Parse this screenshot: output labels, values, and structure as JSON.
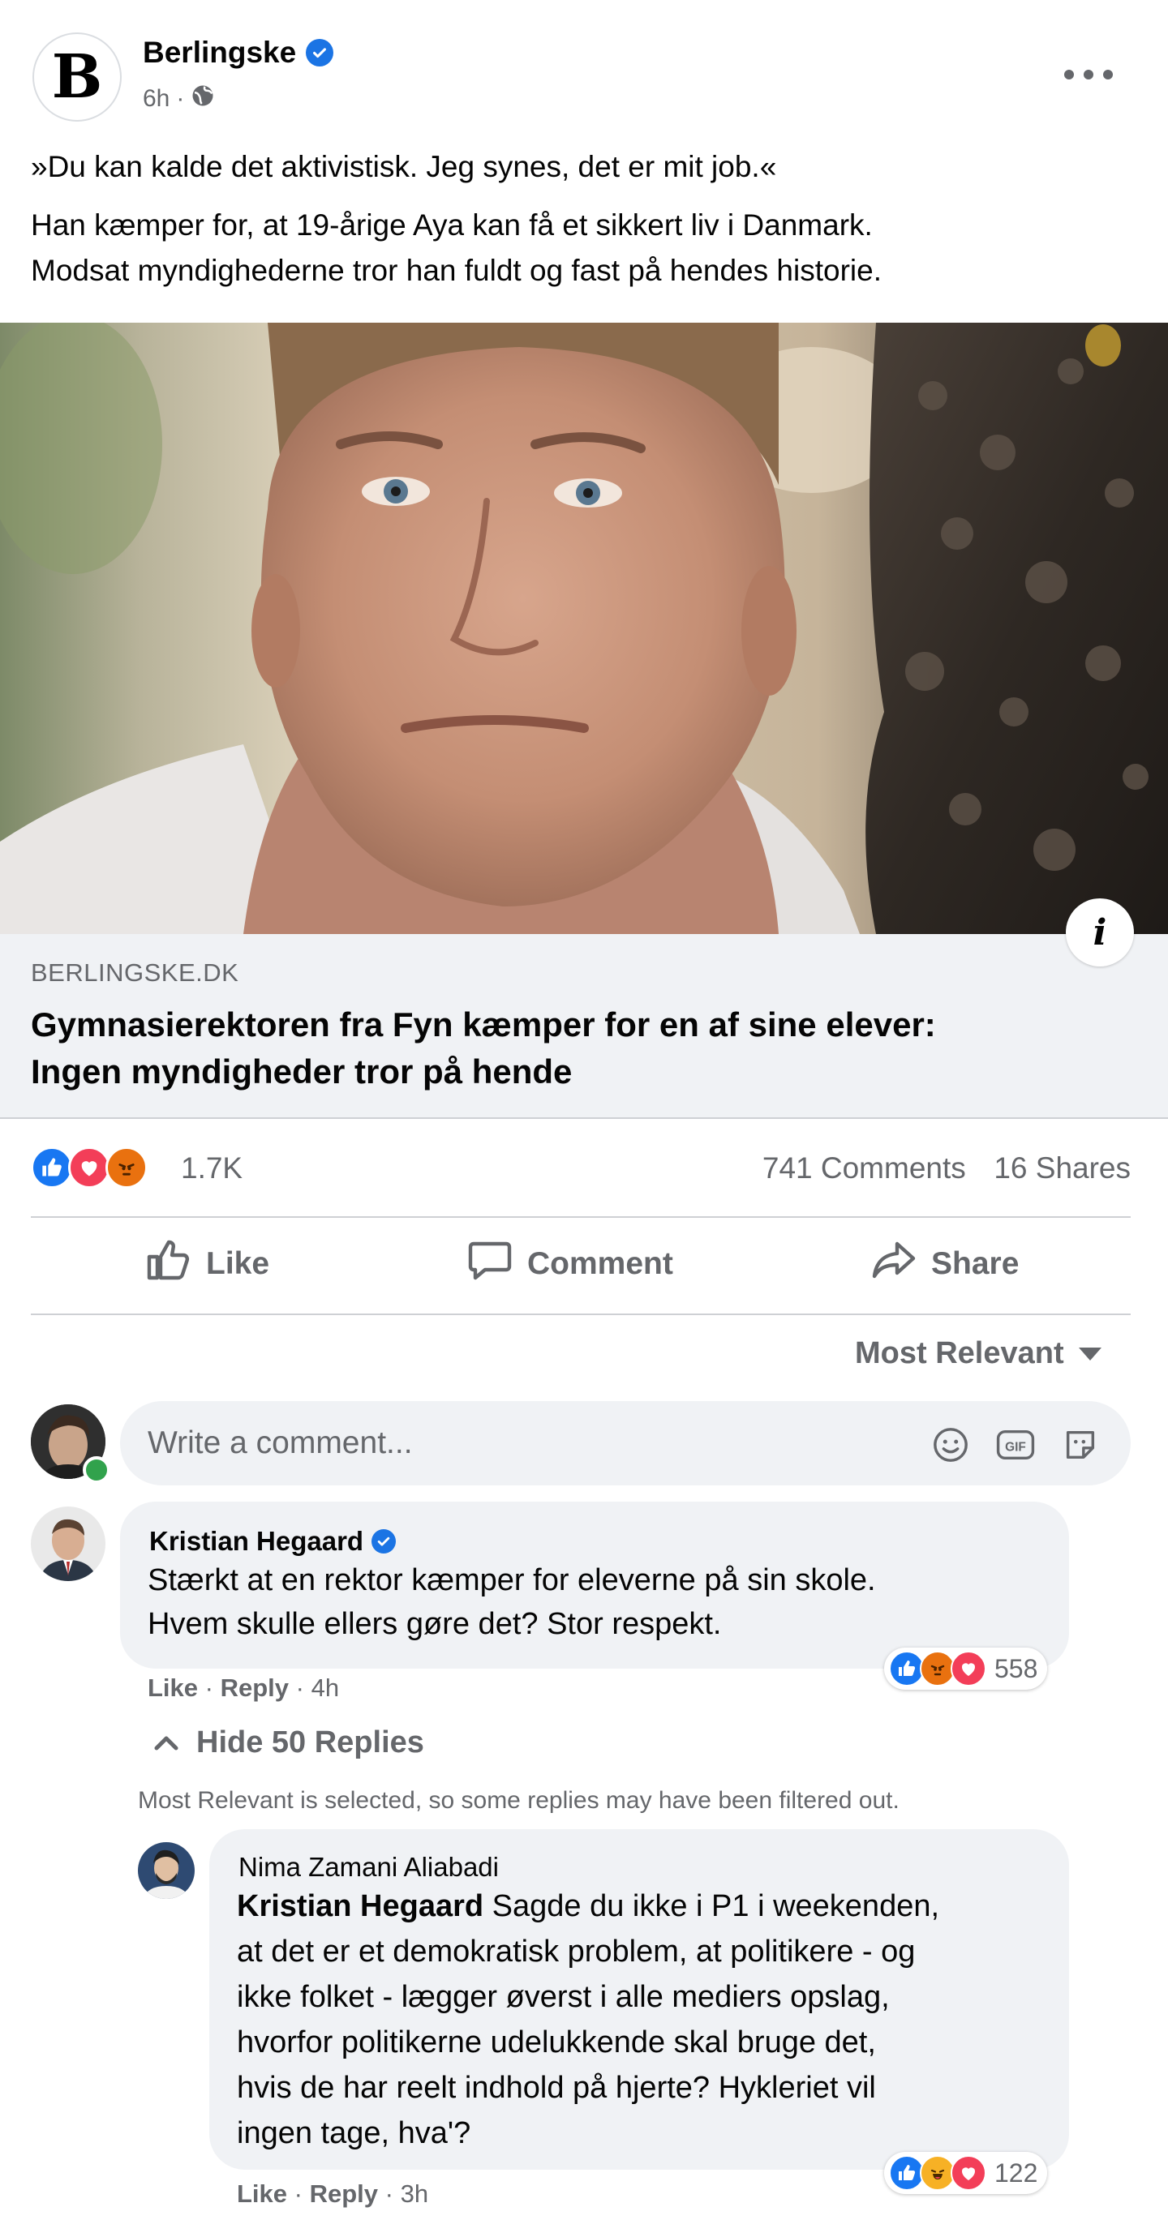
{
  "post": {
    "page_name": "Berlingske",
    "page_initial": "B",
    "time": "6h",
    "time_separator": "·",
    "line1": "»Du kan kalde det aktivistisk. Jeg synes, det er mit job.«",
    "line2a": "Han kæmper for, at 19-årige Aya kan få et sikkert liv i Danmark.",
    "line2b": "Modsat myndighederne tror han fuldt og fast på hendes historie."
  },
  "link": {
    "domain": "BERLINGSKE.DK",
    "title_line1": "Gymnasierektoren fra Fyn kæmper for en af sine elever:",
    "title_line2": "Ingen myndigheder tror på hende",
    "info_glyph": "i"
  },
  "stats": {
    "reactions_count": "1.7K",
    "comments": "741 Comments",
    "shares": "16 Shares"
  },
  "actions": {
    "like": "Like",
    "comment": "Comment",
    "share": "Share"
  },
  "sort": {
    "label": "Most Relevant"
  },
  "composer": {
    "placeholder": "Write a comment..."
  },
  "comments": [
    {
      "author": "Kristian Hegaard",
      "line1": "Stærkt at en rektor kæmper for eleverne på sin skole.",
      "line2": "Hvem skulle ellers gøre det? Stor respekt.",
      "like": "Like",
      "reply": "Reply",
      "sep": "·",
      "time": "4h",
      "reaction_count": "558"
    }
  ],
  "replies_toggle": {
    "label": "Hide 50 Replies"
  },
  "filter_note": "Most Relevant is selected, so some replies may have been filtered out.",
  "reply": {
    "author": "Nima Zamani Aliabadi",
    "mention": "Kristian Hegaard",
    "line1": "Sagde du ikke i P1 i weekenden,",
    "line2": "at det er et demokratisk problem, at politikere - og",
    "line3": "ikke folket - lægger øverst i alle mediers opslag,",
    "line4": "hvorfor politikerne udelukkende skal bruge det,",
    "line5": "hvis de har reelt indhold på hjerte? Hykleriet vil",
    "line6": "ingen tage, hva'?",
    "like": "Like",
    "reply": "Reply",
    "sep": "·",
    "time": "3h",
    "reaction_count": "122"
  },
  "colors": {
    "facebook_blue": "#1b74e4",
    "like_blue": "#1877f2",
    "love_red": "#f33e58",
    "angry_orange": "#e9710f",
    "secondary_text": "#65676b",
    "bubble_bg": "#f0f2f5"
  },
  "icons": [
    "verified-icon",
    "globe-icon",
    "more-icon",
    "info-icon",
    "like-icon",
    "comment-icon",
    "share-icon",
    "chevron-down-icon",
    "emoji-icon",
    "gif-icon",
    "sticker-icon",
    "chevron-up-icon"
  ]
}
